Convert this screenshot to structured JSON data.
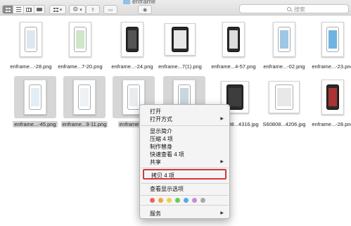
{
  "window": {
    "title": "enframe"
  },
  "toolbar": {
    "view_modes": [
      "grid-icon",
      "list-icon",
      "columns-icon",
      "coverflow-icon"
    ],
    "arrange": "arrange-icon",
    "action": "gear-icon",
    "share": "share-icon",
    "tags": "tag-icon",
    "eye": "eye-icon",
    "search_placeholder": "搜索"
  },
  "files": [
    {
      "name": "enframe...-28.png",
      "selected": false
    },
    {
      "name": "enframe...7-20.png",
      "selected": false
    },
    {
      "name": "enframe...-24.png",
      "selected": false
    },
    {
      "name": "enframe...7(1).png",
      "selected": false
    },
    {
      "name": "enframe...4-57.png",
      "selected": false
    },
    {
      "name": "enframe...-02.png",
      "selected": false
    },
    {
      "name": "enframe...-23.png",
      "selected": false
    },
    {
      "name": "enframe...-45.png",
      "selected": true
    },
    {
      "name": "enframe...9-11.png",
      "selected": true
    },
    {
      "name": "enframe...-4",
      "selected": true
    },
    {
      "name": "",
      "selected": true
    },
    {
      "name": "08...4316.jpg",
      "selected": false
    },
    {
      "name": "S60808...4206.jpg",
      "selected": false
    },
    {
      "name": "enframe...-28.png",
      "selected": false
    }
  ],
  "context_menu": {
    "open": "打开",
    "open_with": "打开方式",
    "show_info": "显示简介",
    "compress": "压缩 4 项",
    "make_alias": "制作替身",
    "quick_look": "快速查看 4 项",
    "share": "共享",
    "copy": "拷贝 4 项",
    "view_options": "查看显示选项",
    "services": "服务",
    "tag_colors": [
      "#e8675d",
      "#f0a546",
      "#eed04a",
      "#6fc85b",
      "#59a7e8",
      "#c58ad8",
      "#a9a9a9"
    ]
  }
}
